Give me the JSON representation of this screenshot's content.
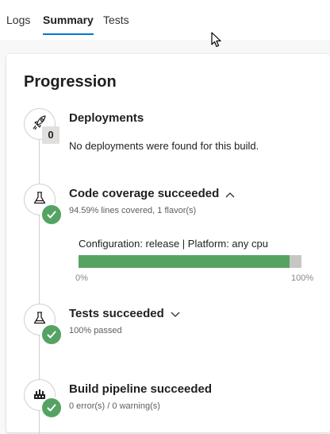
{
  "tabs": [
    {
      "label": "Logs"
    },
    {
      "label": "Summary"
    },
    {
      "label": "Tests"
    }
  ],
  "active_tab": "Summary",
  "progression": {
    "title": "Progression",
    "deployments": {
      "title": "Deployments",
      "icon": "rocket-icon",
      "count": "0",
      "message": "No deployments were found for this build."
    },
    "coverage": {
      "title": "Code coverage succeeded",
      "icon": "flask-icon",
      "status": "succeeded",
      "subtitle": "94.59% lines covered, 1 flavor(s)",
      "config_line": "Configuration: release | Platform: any cpu",
      "percent": 94.59,
      "min_label": "0%",
      "max_label": "100%",
      "expanded": true
    },
    "tests": {
      "title": "Tests succeeded",
      "icon": "flask-icon",
      "status": "succeeded",
      "subtitle": "100% passed",
      "expanded": false
    },
    "build": {
      "title": "Build pipeline succeeded",
      "icon": "pipeline-icon",
      "status": "succeeded",
      "subtitle": "0 error(s) / 0 warning(s)"
    }
  },
  "colors": {
    "accent": "#0078d4",
    "success": "#55a362",
    "bar_track": "#c8c6c4"
  }
}
